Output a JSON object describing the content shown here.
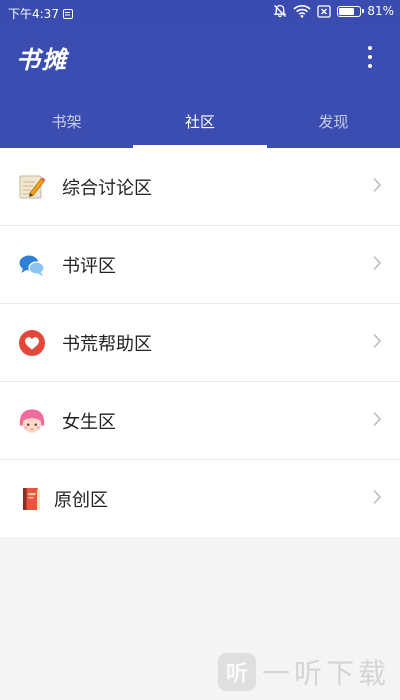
{
  "status_bar": {
    "time": "下午4:37",
    "battery": "81%",
    "battery_level": 0.81
  },
  "app": {
    "title": "书摊"
  },
  "tabs": [
    {
      "label": "书架",
      "active": false
    },
    {
      "label": "社区",
      "active": true
    },
    {
      "label": "发现",
      "active": false
    }
  ],
  "community": {
    "items": [
      {
        "label": "综合讨论区",
        "icon": "notepad-pencil-icon"
      },
      {
        "label": "书评区",
        "icon": "chat-bubbles-icon"
      },
      {
        "label": "书荒帮助区",
        "icon": "heart-icon"
      },
      {
        "label": "女生区",
        "icon": "girl-face-icon"
      },
      {
        "label": "原创区",
        "icon": "book-icon"
      }
    ]
  },
  "watermark": {
    "logo_text": "听",
    "text": "一听下载"
  },
  "colors": {
    "primary": "#3c4db1",
    "status_bar": "#3b4cb0",
    "background": "#f4f4f4",
    "heart_red": "#e2483a",
    "girl_pink": "#f06aa0"
  }
}
